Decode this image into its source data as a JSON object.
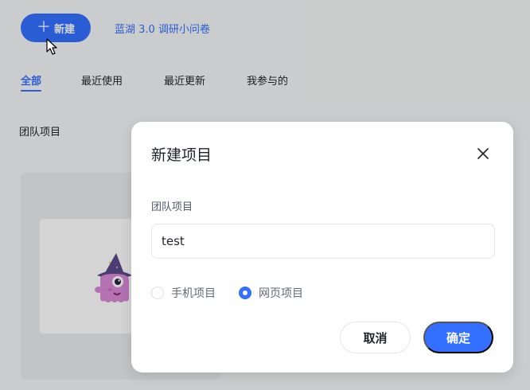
{
  "header": {
    "new_button_label": "新建",
    "survey_link": "蓝湖 3.0 调研小问卷"
  },
  "tabs": [
    {
      "label": "全部",
      "active": true
    },
    {
      "label": "最近使用",
      "active": false
    },
    {
      "label": "最近更新",
      "active": false
    },
    {
      "label": "我参与的",
      "active": false
    }
  ],
  "section": {
    "title": "团队项目"
  },
  "modal": {
    "title": "新建项目",
    "field_label": "团队项目",
    "name_value": "test",
    "options": [
      {
        "label": "手机项目",
        "checked": false
      },
      {
        "label": "网页项目",
        "checked": true
      }
    ],
    "cancel_label": "取消",
    "confirm_label": "确定"
  },
  "icons": {
    "plus": "plus-icon",
    "close": "close-icon",
    "cursor": "mouse-cursor-icon",
    "mascot": "mascot-illustration"
  },
  "colors": {
    "accent": "#3370ff",
    "mask": "rgba(0,0,0,0.17)",
    "mascot_body": "#d98ad6",
    "mascot_hat": "#5b4a8c"
  }
}
